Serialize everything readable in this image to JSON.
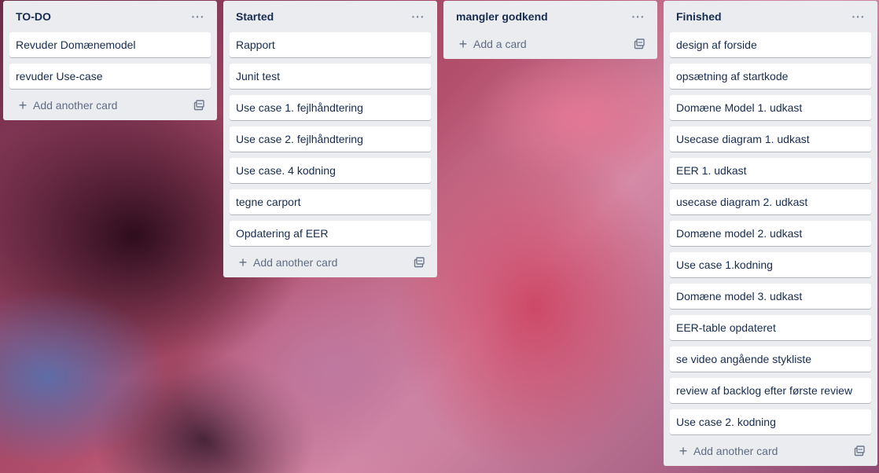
{
  "lists": [
    {
      "title": "TO-DO",
      "menu": "···",
      "cards": [
        "Revuder Domænemodel",
        "revuder Use-case"
      ],
      "add_label": "Add another card"
    },
    {
      "title": "Started",
      "menu": "···",
      "cards": [
        "Rapport",
        "Junit test",
        "Use case 1. fejlhåndtering",
        "Use case 2. fejlhåndtering",
        "Use case. 4 kodning",
        "tegne carport",
        "Opdatering af EER"
      ],
      "add_label": "Add another card"
    },
    {
      "title": "mangler godkend",
      "menu": "···",
      "cards": [],
      "add_label": "Add a card"
    },
    {
      "title": "Finished",
      "menu": "···",
      "cards": [
        "design af forside",
        "opsætning af startkode",
        "Domæne Model 1. udkast",
        "Usecase diagram 1. udkast",
        "EER 1. udkast",
        "usecase diagram 2. udkast",
        "Domæne model 2. udkast",
        "Use case 1.kodning",
        "Domæne model 3. udkast",
        "EER-table opdateret",
        "se video angående stykliste",
        "review af backlog efter første review",
        "Use case 2. kodning"
      ],
      "add_label": "Add another card"
    }
  ],
  "icons": {
    "plus": "plus-icon",
    "template": "card-template-icon",
    "menu": "more-icon"
  }
}
